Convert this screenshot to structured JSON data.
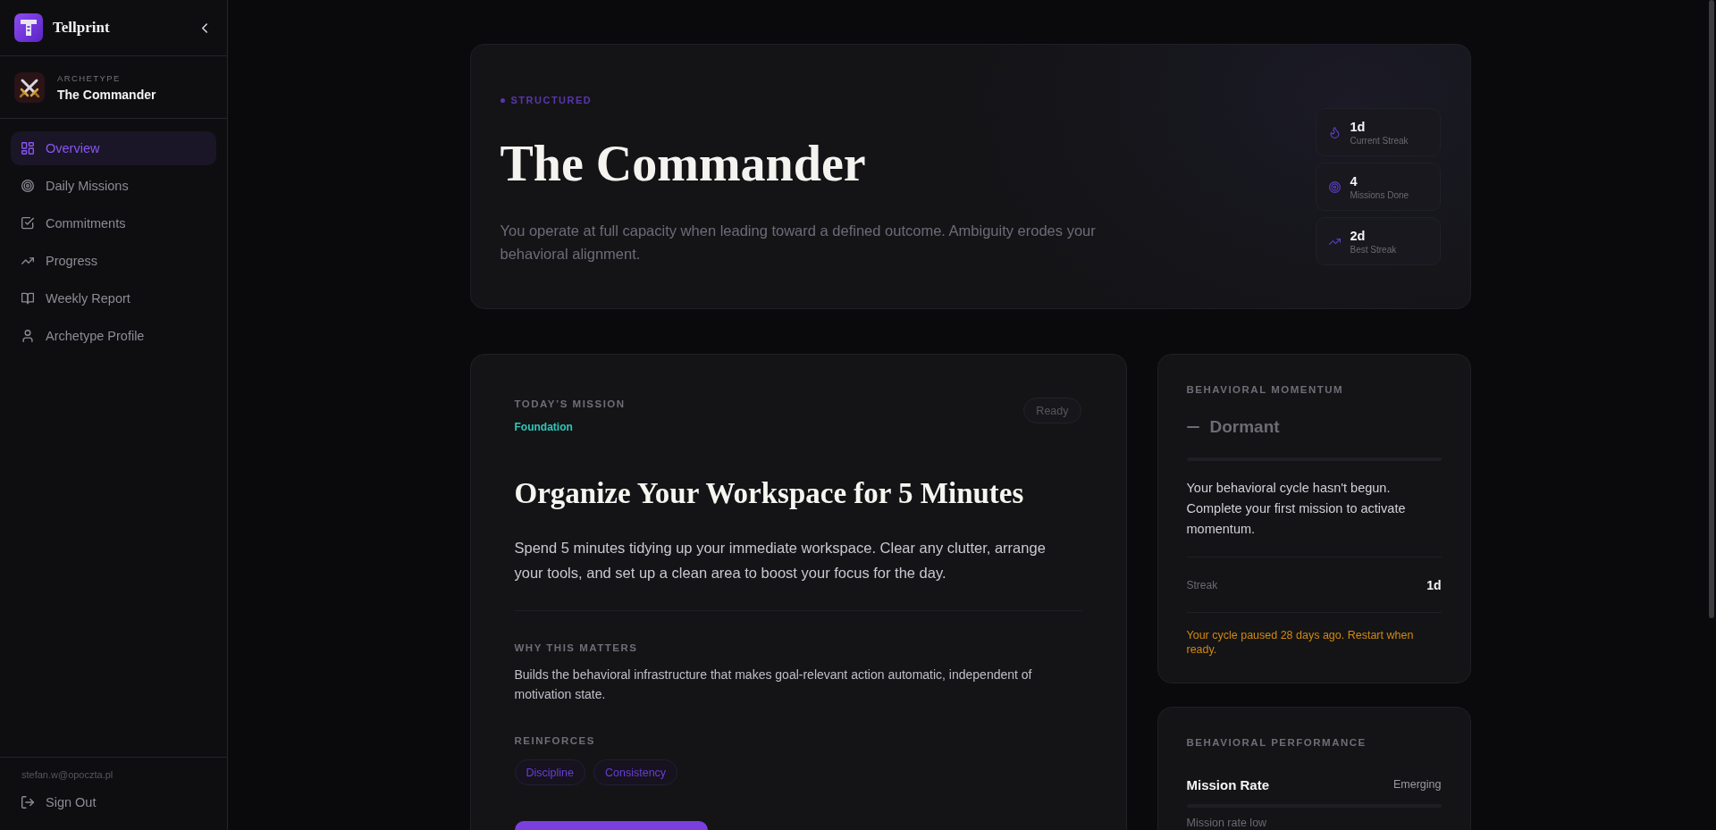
{
  "sidebar": {
    "brand": "Tellprint",
    "archetype": {
      "label": "ARCHETYPE",
      "name": "The Commander"
    },
    "nav": [
      {
        "label": "Overview",
        "selected": true
      },
      {
        "label": "Daily Missions",
        "selected": false
      },
      {
        "label": "Commitments",
        "selected": false
      },
      {
        "label": "Progress",
        "selected": false
      },
      {
        "label": "Weekly Report",
        "selected": false
      },
      {
        "label": "Archetype Profile",
        "selected": false
      }
    ],
    "user_email": "stefan.w@opoczta.pl",
    "sign_out": "Sign Out"
  },
  "hero": {
    "tag": "STRUCTURED",
    "title": "The Commander",
    "description": "You operate at full capacity when leading toward a defined outcome. Ambiguity erodes your behavioral alignment.",
    "stats": [
      {
        "value": "1d",
        "label": "Current Streak"
      },
      {
        "value": "4",
        "label": "Missions Done"
      },
      {
        "value": "2d",
        "label": "Best Streak"
      }
    ]
  },
  "mission": {
    "eyebrow": "TODAY’S MISSION",
    "category": "Foundation",
    "status": "Ready",
    "title": "Organize Your Workspace for 5 Minutes",
    "description": "Spend 5 minutes tidying up your immediate workspace. Clear any clutter, arrange your tools, and set up a clean area to boost your focus for the day.",
    "why_heading": "WHY THIS MATTERS",
    "why_text": "Builds the behavioral infrastructure that makes goal-relevant action automatic, independent of motivation state.",
    "reinforces_heading": "REINFORCES",
    "tags": [
      "Discipline",
      "Consistency"
    ]
  },
  "momentum": {
    "heading": "BEHAVIORAL MOMENTUM",
    "state": "Dormant",
    "level": 0,
    "message": "Your behavioral cycle hasn't begun. Complete your first mission to activate momentum.",
    "streak_label": "Streak",
    "streak_value": "1d",
    "notice": "Your cycle paused 28 days ago. Restart when ready."
  },
  "performance": {
    "heading": "BEHAVIORAL PERFORMANCE",
    "metrics": [
      {
        "name": "Mission Rate",
        "rating": "Emerging",
        "level": 0,
        "note": "Mission rate low"
      }
    ]
  }
}
